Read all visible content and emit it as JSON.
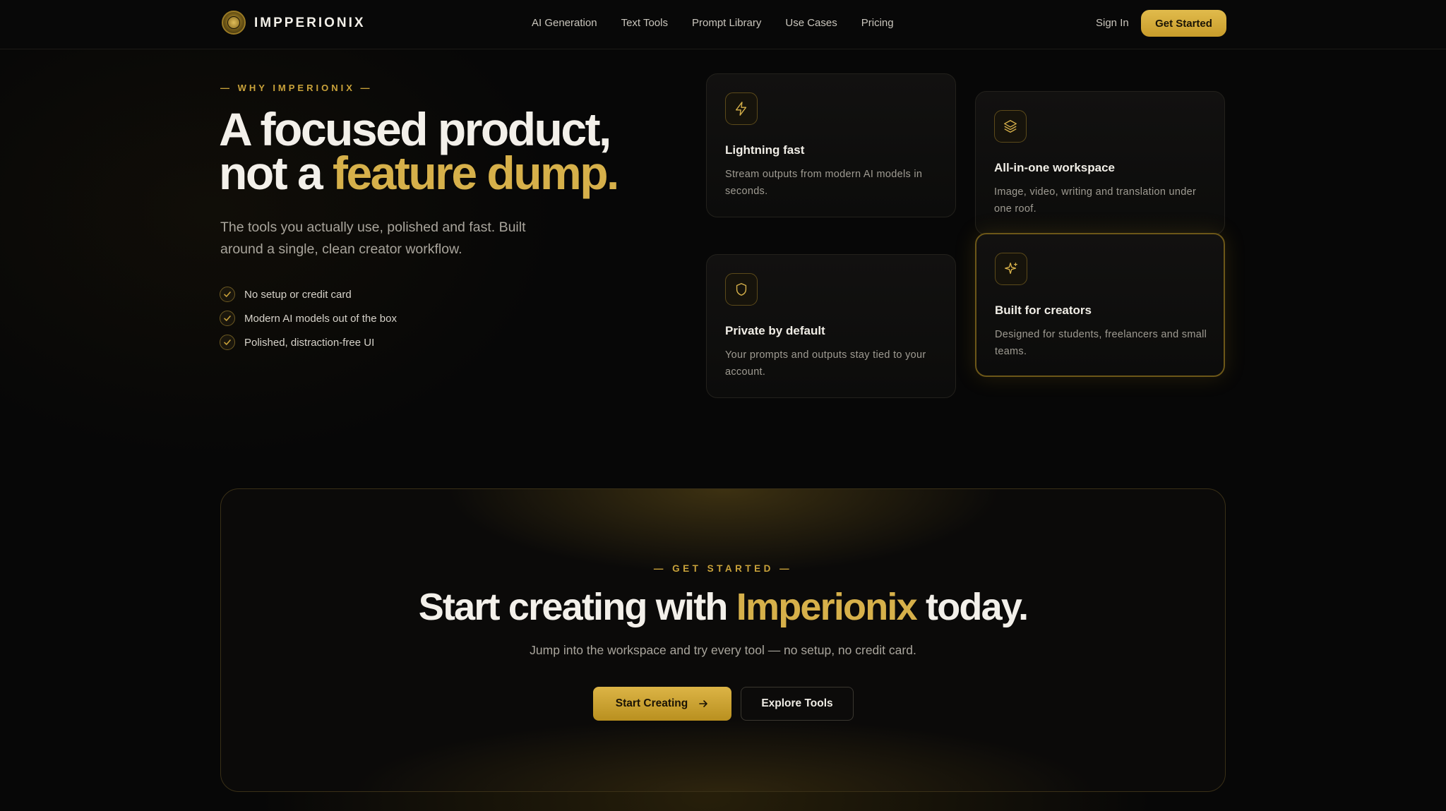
{
  "nav": {
    "brand": "IMPPERIONIX",
    "links": [
      "AI Generation",
      "Text Tools",
      "Prompt Library",
      "Use Cases",
      "Pricing"
    ],
    "sign_in": "Sign In",
    "cta": "Get Started"
  },
  "hero": {
    "eyebrow": "— WHY IMPERIONIX —",
    "headline_line1": "A focused product,",
    "headline_line2_prefix": "not a ",
    "headline_line2_gold": "feature dump.",
    "subcopy": "The tools you actually use, polished and fast. Built around a single, clean creator workflow.",
    "checks": [
      "No setup or credit card",
      "Modern AI models out of the box",
      "Polished, distraction-free UI"
    ]
  },
  "features": [
    {
      "icon": "lightning-icon",
      "title": "Lightning fast",
      "desc": "Stream outputs from modern AI models in seconds."
    },
    {
      "icon": "layers-icon",
      "title": "All-in-one workspace",
      "desc": "Image, video, writing and translation under one roof."
    },
    {
      "icon": "shield-icon",
      "title": "Private by default",
      "desc": "Your prompts and outputs stay tied to your account."
    },
    {
      "icon": "sparkle-icon",
      "title": "Built for creators",
      "desc": "Designed for students, freelancers and small teams."
    }
  ],
  "cta": {
    "eyebrow": "— GET STARTED —",
    "title_prefix": "Start creating with ",
    "title_gold": "Imperionix",
    "title_suffix": " today.",
    "sub": "Jump into the workspace and try every tool — no setup, no credit card.",
    "primary": "Start Creating",
    "secondary": "Explore Tools"
  },
  "colors": {
    "accent": "#d6b04a",
    "background": "#070707",
    "border": "#23211c"
  }
}
